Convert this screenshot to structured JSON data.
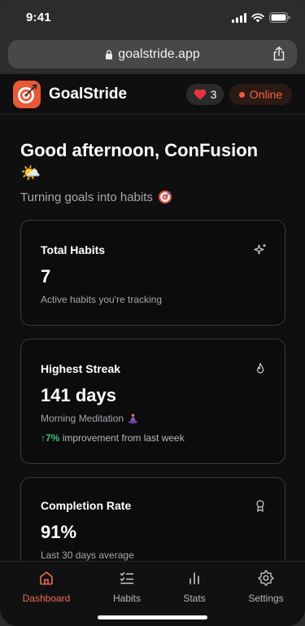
{
  "status": {
    "time": "9:41"
  },
  "browser": {
    "url": "goalstride.app"
  },
  "header": {
    "brand": "GoalStride",
    "hearts": "3",
    "online": "Online"
  },
  "greeting": {
    "title": "Good afternoon, ConFusion",
    "emoji": "🌤️",
    "tagline": "Turning goals into habits"
  },
  "cards": {
    "total": {
      "title": "Total Habits",
      "value": "7",
      "sub": "Active habits you're tracking",
      "icon": "sparkle-icon"
    },
    "streak": {
      "title": "Highest Streak",
      "value": "141 days",
      "sub": "Morning Meditation",
      "trend_value": "↑7%",
      "trend_text": "improvement from last week",
      "icon": "flame-icon"
    },
    "completion": {
      "title": "Completion Rate",
      "value": "91%",
      "sub": "Last 30 days average",
      "icon": "award-icon"
    }
  },
  "nav": [
    {
      "label": "Dashboard",
      "icon": "home-icon",
      "active": true
    },
    {
      "label": "Habits",
      "icon": "checklist-icon",
      "active": false
    },
    {
      "label": "Stats",
      "icon": "bar-chart-icon",
      "active": false
    },
    {
      "label": "Settings",
      "icon": "gear-icon",
      "active": false
    }
  ],
  "colors": {
    "accent": "#f26a4b",
    "background": "#0f0f10",
    "positive": "#34c27a"
  }
}
